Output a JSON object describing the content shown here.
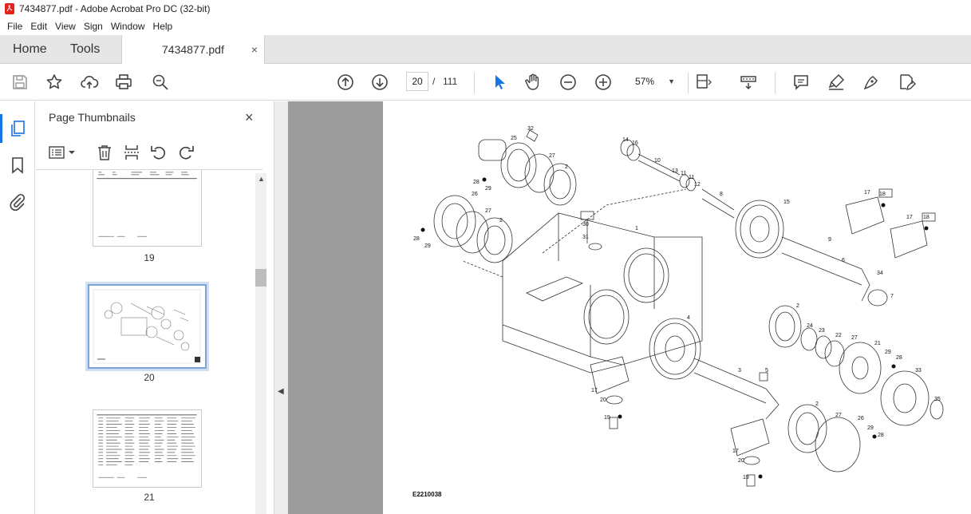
{
  "window": {
    "title": "7434877.pdf - Adobe Acrobat Pro DC (32-bit)"
  },
  "menu": [
    "File",
    "Edit",
    "View",
    "Sign",
    "Window",
    "Help"
  ],
  "tabs": {
    "home": "Home",
    "tools": "Tools",
    "document": "7434877.pdf",
    "close": "×"
  },
  "toolbar": {
    "page_current": "20",
    "page_sep": "/",
    "page_total": "111",
    "zoom": "57%",
    "icons": [
      "save-icon",
      "star-icon",
      "cloud-upload-icon",
      "print-icon",
      "zoom-search-icon",
      "prev-page-icon",
      "next-page-icon",
      "select-cursor-icon",
      "hand-icon",
      "zoom-out-icon",
      "zoom-in-icon",
      "page-fit-icon",
      "scroll-mode-icon",
      "comment-icon",
      "highlight-icon",
      "draw-icon",
      "fill-sign-icon"
    ]
  },
  "panel": {
    "title": "Page Thumbnails",
    "close": "×",
    "thumbnails": [
      {
        "number": "19"
      },
      {
        "number": "20",
        "selected": true
      },
      {
        "number": "21"
      }
    ]
  },
  "document": {
    "figure_code": "E2210038",
    "callouts": [
      "32",
      "25",
      "27",
      "2",
      "28",
      "29",
      "26",
      "27",
      "2",
      "28",
      "29",
      "14",
      "16",
      "10",
      "13",
      "11",
      "11",
      "12",
      "8",
      "30",
      "31",
      "1",
      "15",
      "17",
      "18",
      "17",
      "18",
      "9",
      "6",
      "34",
      "7",
      "2",
      "24",
      "23",
      "22",
      "27",
      "21",
      "29",
      "28",
      "4",
      "3",
      "5",
      "33",
      "17",
      "20",
      "19",
      "2",
      "27",
      "26",
      "35",
      "29",
      "28",
      "17",
      "20",
      "19"
    ]
  },
  "colors": {
    "accent": "#1473e6",
    "doc_background": "#9c9c9c",
    "tabbar": "#e6e6e6",
    "pdf_red": "#e2231a"
  }
}
